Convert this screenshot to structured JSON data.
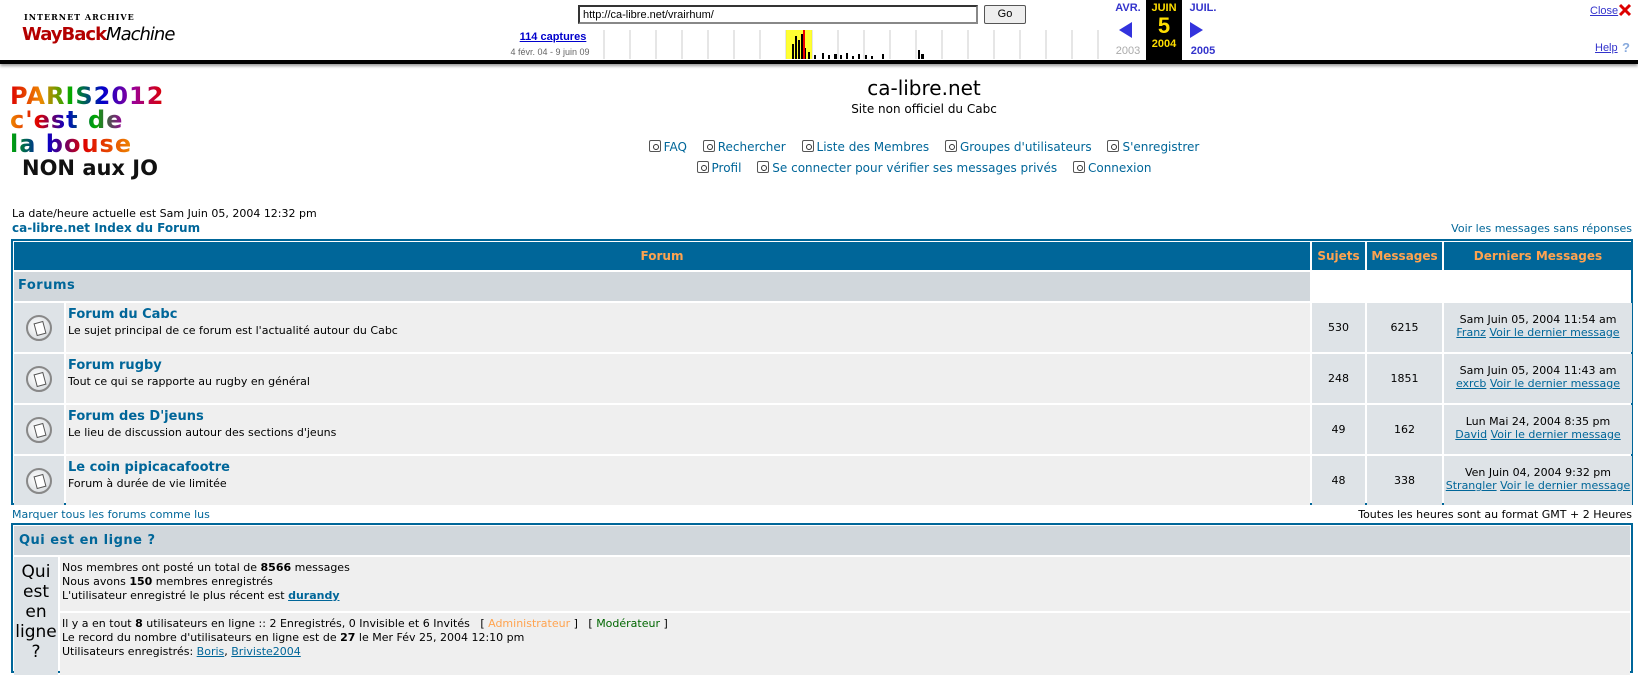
{
  "wayback": {
    "logo_top": "INTERNET ARCHIVE",
    "logo_main_1": "WayBack",
    "logo_main_2": "Machine",
    "url": "http://ca-libre.net/vrairhum/",
    "go_label": "Go",
    "captures": "114 captures",
    "range": "4 févr. 04 - 9 juin 09",
    "prev_month": "AVR.",
    "cur_month": "JUIN",
    "next_month": "JUIL.",
    "cur_day": "5",
    "prev_year": "2003",
    "cur_year": "2004",
    "next_year": "2005",
    "close_label": "Close",
    "help_label": "Help",
    "help_glyph": "?"
  },
  "site": {
    "logo_line1": "PARIS2012",
    "logo_line2": "c'est de",
    "logo_line3": "la bouse",
    "logo_line4": "NON aux JO",
    "title": "ca-libre.net",
    "subtitle": "Site non officiel du Cabc"
  },
  "nav": {
    "faq": "FAQ",
    "search": "Rechercher",
    "members": "Liste des Membres",
    "groups": "Groupes d'utilisateurs",
    "register": "S'enregistrer",
    "profile": "Profil",
    "pm": "Se connecter pour vérifier ses messages privés",
    "login": "Connexion"
  },
  "page": {
    "current_date": "La date/heure actuelle est Sam Juin 05, 2004 12:32 pm",
    "index_link": "ca-libre.net Index du Forum",
    "unanswered": "Voir les messages sans réponses",
    "mark_read": "Marquer tous les forums comme lus",
    "timezone": "Toutes les heures sont au format GMT + 2 Heures"
  },
  "table": {
    "col_forum": "Forum",
    "col_topics": "Sujets",
    "col_posts": "Messages",
    "col_last": "Derniers Messages",
    "category": "Forums",
    "forums": [
      {
        "name": "Forum du Cabc",
        "desc": "Le sujet principal de ce forum est l'actualité autour du Cabc",
        "topics": "530",
        "posts": "6215",
        "last_date": "Sam Juin 05, 2004 11:54 am",
        "last_user": "Franz",
        "last_link": "Voir le dernier message"
      },
      {
        "name": "Forum rugby",
        "desc": "Tout ce qui se rapporte au rugby en général",
        "topics": "248",
        "posts": "1851",
        "last_date": "Sam Juin 05, 2004 11:43 am",
        "last_user": "exrcb",
        "last_link": "Voir le dernier message"
      },
      {
        "name": "Forum des D'jeuns",
        "desc": "Le lieu de discussion autour des sections d'jeuns",
        "topics": "49",
        "posts": "162",
        "last_date": "Lun Mai 24, 2004 8:35 pm",
        "last_user": "David",
        "last_link": "Voir le dernier message"
      },
      {
        "name": "Le coin pipicacafootre",
        "desc": "Forum à durée de vie limitée",
        "topics": "48",
        "posts": "338",
        "last_date": "Ven Juin 04, 2004 9:32 pm",
        "last_user": "Strangler",
        "last_link": "Voir le dernier message"
      }
    ]
  },
  "online": {
    "title": "Qui est en ligne ?",
    "side_text": "Qui est en ligne ?",
    "stat1_pre": "Nos membres ont posté un total de ",
    "stat1_num": "8566",
    "stat1_post": " messages",
    "stat2_pre": "Nous avons ",
    "stat2_num": "150",
    "stat2_post": " membres enregistrés",
    "stat3_pre": "L'utilisateur enregistré le plus récent est ",
    "stat3_user": "durandy",
    "users1_pre": "Il y a en tout ",
    "users1_num": "8",
    "users1_post": " utilisateurs en ligne :: 2 Enregistrés, 0 Invisible et 6 Invités",
    "admin_label": "Administrateur",
    "mod_label": "Modérateur",
    "users2_pre": "Le record du nombre d'utilisateurs en ligne est de ",
    "users2_num": "27",
    "users2_post": " le Mer Fév 25, 2004 12:10 pm",
    "users3_pre": "Utilisateurs enregistrés: ",
    "user_a": "Boris",
    "user_b": "Briviste2004"
  },
  "colors": {
    "header_bg": "#006699",
    "header_text": "#ffa34f",
    "row_light": "#efefef",
    "row_dark": "#dee3e7",
    "cat_bg": "#d1d7dc"
  }
}
